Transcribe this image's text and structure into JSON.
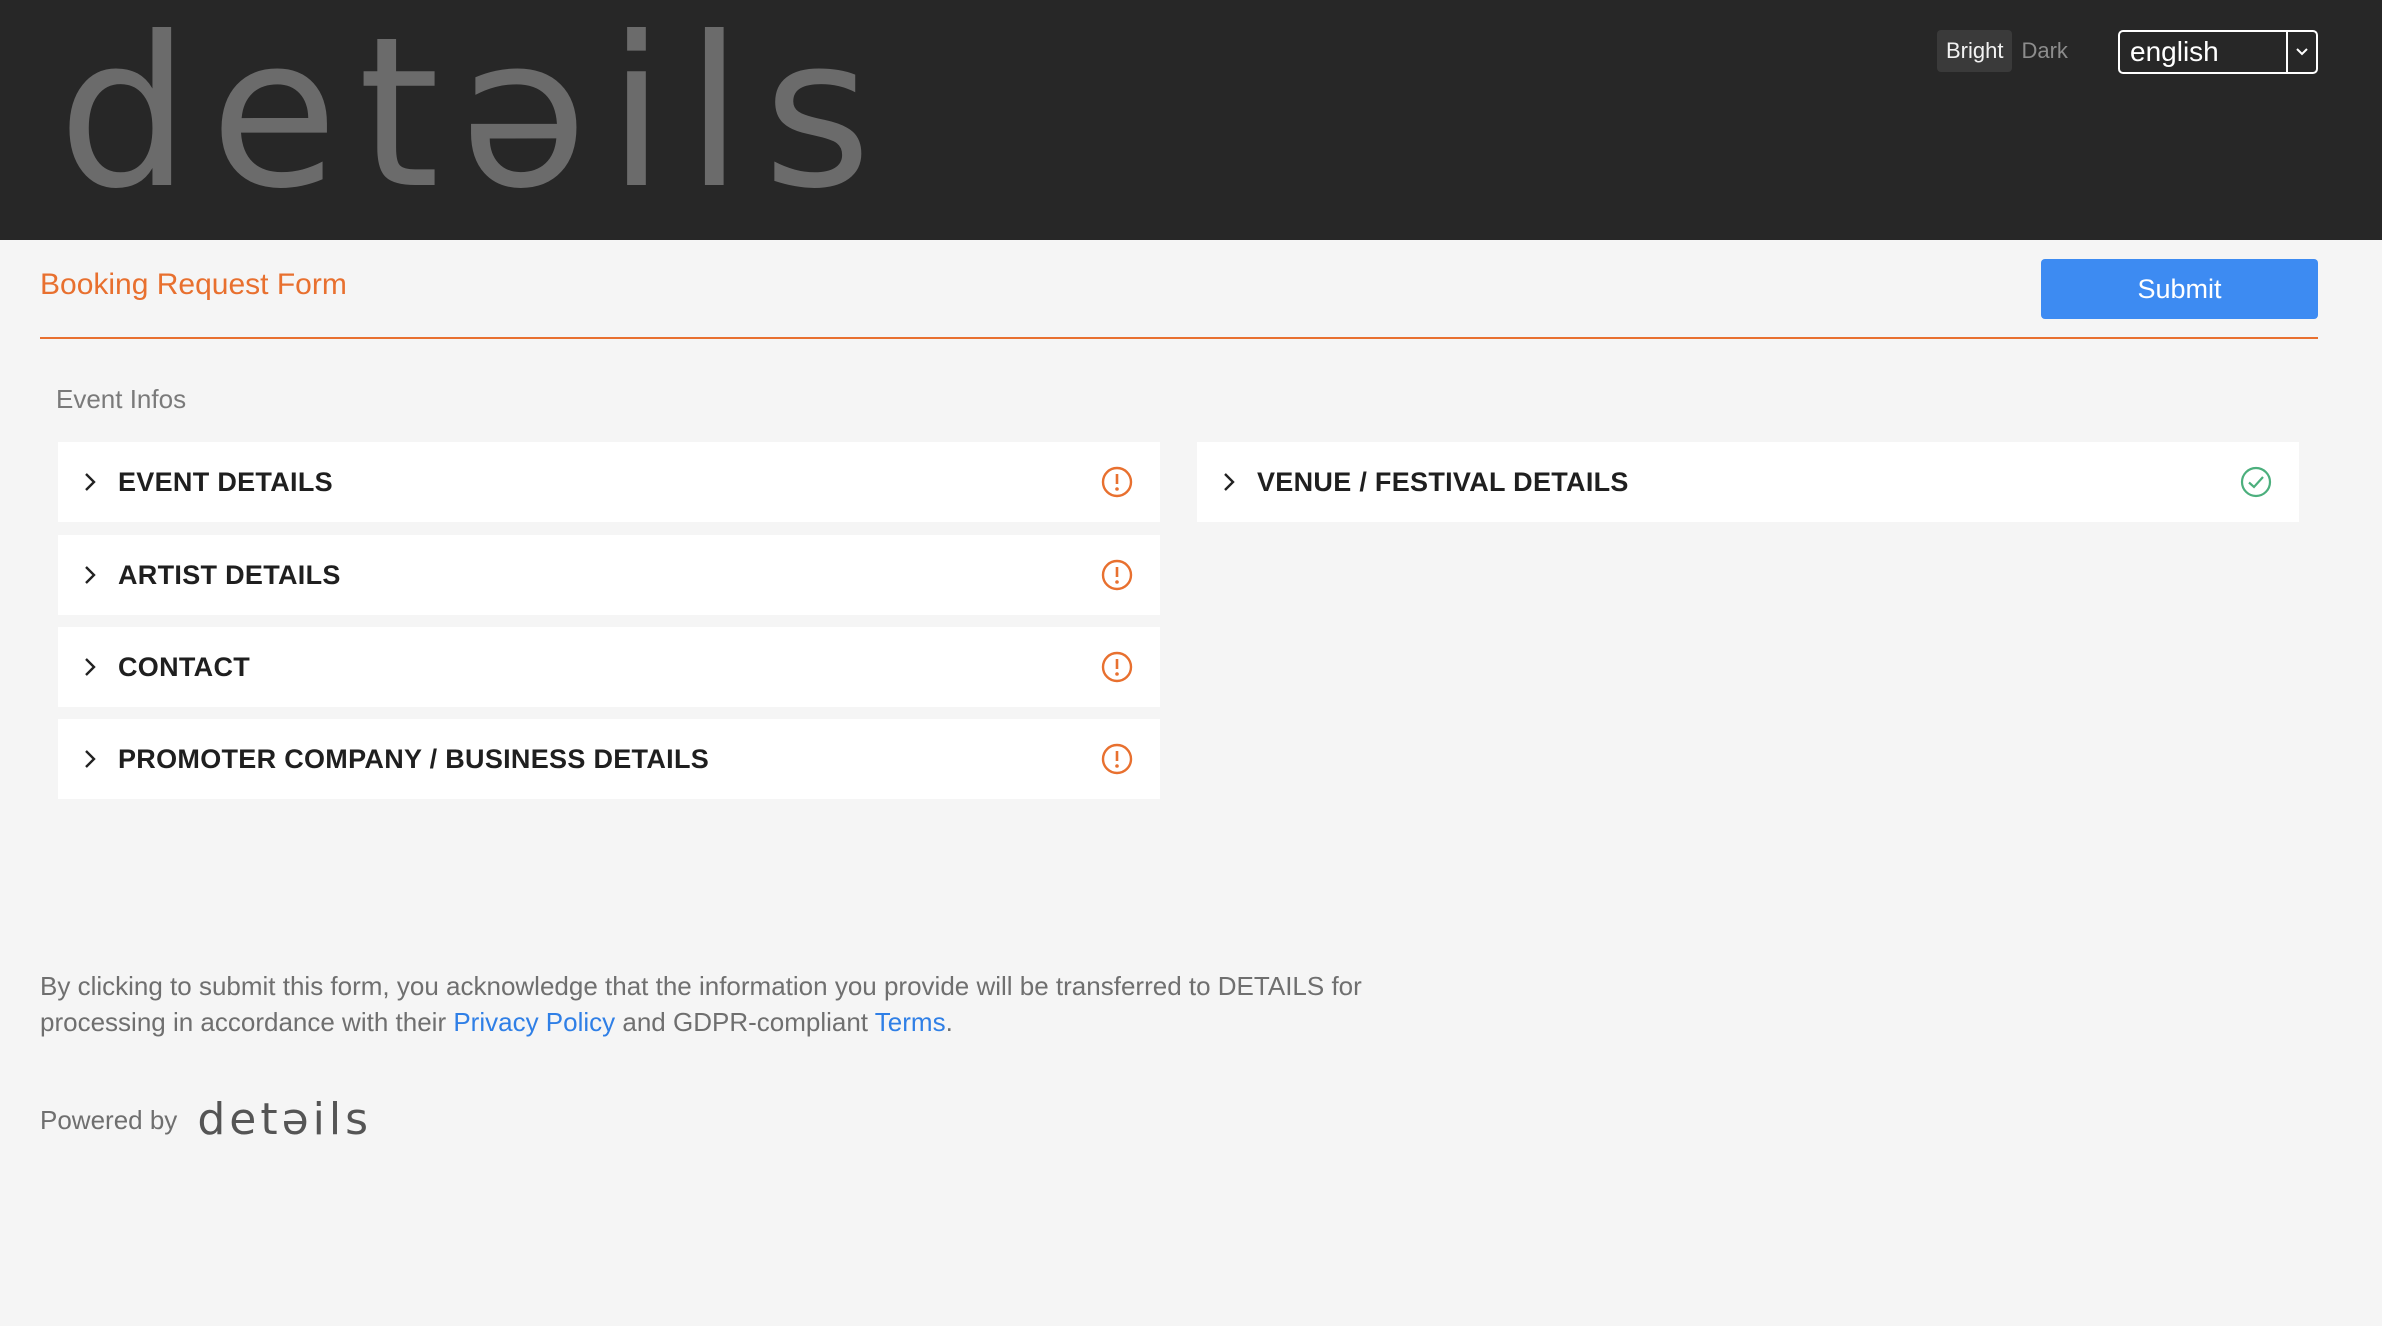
{
  "header": {
    "logo_text": "detəils",
    "theme": {
      "bright_label": "Bright",
      "dark_label": "Dark",
      "active": "Bright"
    },
    "language": {
      "selected": "english"
    }
  },
  "form": {
    "title": "Booking Request Form",
    "submit_label": "Submit",
    "section_label": "Event Infos",
    "accent_color": "#e8702f"
  },
  "panels": {
    "left": [
      {
        "label": "EVENT DETAILS",
        "status": "warning"
      },
      {
        "label": "ARTIST DETAILS",
        "status": "warning"
      },
      {
        "label": "CONTACT",
        "status": "warning"
      },
      {
        "label": "PROMOTER COMPANY / BUSINESS DETAILS",
        "status": "warning"
      }
    ],
    "right": [
      {
        "label": "VENUE / FESTIVAL DETAILS",
        "status": "complete"
      }
    ]
  },
  "footer": {
    "consent_part1": "By clicking to submit this form, you acknowledge that the information you provide will be transferred to DETAILS for processing in accordance with their ",
    "privacy_link": "Privacy Policy",
    "consent_part2": " and GDPR-compliant ",
    "terms_link": "Terms",
    "consent_part3": ".",
    "powered_label": "Powered by",
    "powered_logo": "detəils"
  },
  "colors": {
    "header_bg": "#272727",
    "submit_bg": "#3d8bf2",
    "warning": "#e8702f",
    "complete": "#4caf7d",
    "link": "#2f7fe6"
  }
}
